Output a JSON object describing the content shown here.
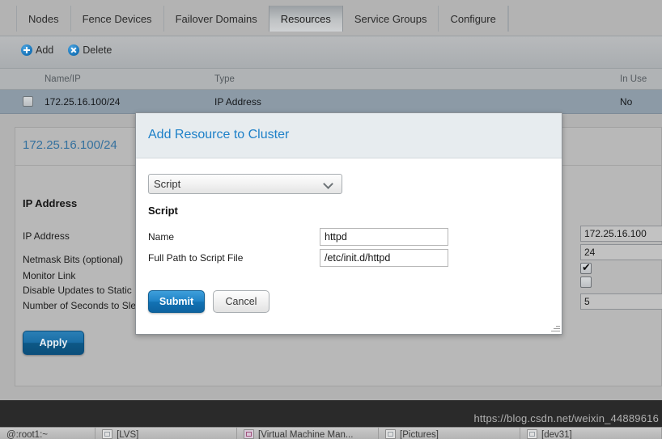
{
  "tabs": [
    {
      "label": "Nodes",
      "active": false
    },
    {
      "label": "Fence Devices",
      "active": false
    },
    {
      "label": "Failover Domains",
      "active": false
    },
    {
      "label": "Resources",
      "active": true
    },
    {
      "label": "Service Groups",
      "active": false
    },
    {
      "label": "Configure",
      "active": false
    }
  ],
  "toolbar": {
    "add_label": "Add",
    "delete_label": "Delete",
    "add_icon": "plus-circle-icon",
    "delete_icon": "x-circle-icon"
  },
  "table": {
    "columns": [
      "Name/IP",
      "Type",
      "In Use"
    ],
    "rows": [
      {
        "name": "172.25.16.100/24",
        "type": "IP Address",
        "in_use": "No",
        "selected": false
      }
    ]
  },
  "detail": {
    "title": "172.25.16.100/24",
    "section": "IP Address",
    "fields": [
      {
        "label": "IP Address",
        "value": "172.25.16.100",
        "kind": "text"
      },
      {
        "label": "Netmask Bits (optional)",
        "value": "24",
        "kind": "text"
      },
      {
        "label": "Monitor Link",
        "value": "",
        "kind": "checkbox",
        "checked": true
      },
      {
        "label": "Disable Updates to Static Routes",
        "value": "",
        "kind": "checkbox",
        "checked": false
      },
      {
        "label": "Number of Seconds to Sleep After Removing an IP Address",
        "value": "5",
        "kind": "text"
      }
    ],
    "apply_label": "Apply"
  },
  "modal": {
    "title": "Add Resource to Cluster",
    "type_select": {
      "value": "Script",
      "options": [
        "Script"
      ]
    },
    "section": "Script",
    "fields": [
      {
        "label": "Name",
        "value": "httpd"
      },
      {
        "label": "Full Path to Script File",
        "value": "/etc/init.d/httpd"
      }
    ],
    "submit_label": "Submit",
    "cancel_label": "Cancel"
  },
  "watermark": "https://blog.csdn.net/weixin_44889616",
  "taskbar": {
    "items": [
      {
        "label": "@:root1:~",
        "icon": "terminal-icon"
      },
      {
        "label": "[LVS]",
        "icon": "window-icon"
      },
      {
        "label": "[Virtual Machine Man...",
        "icon": "vm-icon"
      },
      {
        "label": "[Pictures]",
        "icon": "window-icon"
      },
      {
        "label": "[dev31]",
        "icon": "window-icon"
      }
    ]
  },
  "colors": {
    "accent_blue": "#1d80c8",
    "link_blue": "#35719e",
    "row_selected": "#8c9aa6",
    "app_bg": "#b2b2b2",
    "modal_head": "#e7ecef"
  }
}
